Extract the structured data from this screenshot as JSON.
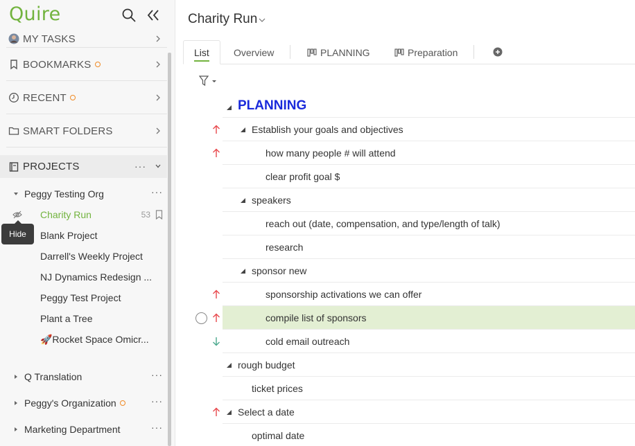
{
  "app": {
    "logo": "Quire",
    "accent": "#72b33e"
  },
  "sidebar": {
    "nav": [
      {
        "label": "MY TASKS",
        "icon": "avatar-icon"
      },
      {
        "label": "BOOKMARKS",
        "icon": "bookmark-icon",
        "dot": true
      },
      {
        "label": "RECENT",
        "icon": "clock-icon",
        "dot": true
      },
      {
        "label": "SMART FOLDERS",
        "icon": "folder-icon"
      }
    ],
    "projects_label": "PROJECTS",
    "orgs": [
      {
        "name": "Peggy Testing Org",
        "expanded": true,
        "projects": [
          {
            "name": "Charity Run",
            "count": "53",
            "active": true
          },
          {
            "name": "Blank Project"
          },
          {
            "name": "Darrell's Weekly Project"
          },
          {
            "name": "NJ Dynamics Redesign ..."
          },
          {
            "name": "Peggy Test Project"
          },
          {
            "name": "Plant a Tree"
          },
          {
            "name": "🚀Rocket Space Omicr..."
          }
        ]
      },
      {
        "name": "Q Translation"
      },
      {
        "name": "Peggy's Organization",
        "dot": true
      },
      {
        "name": "Marketing Department"
      }
    ],
    "tooltip": "Hide"
  },
  "main": {
    "title": "Charity Run",
    "tabs": [
      {
        "label": "List",
        "active": true
      },
      {
        "label": "Overview"
      },
      {
        "label": "PLANNING",
        "icon": "board-icon"
      },
      {
        "label": "Preparation",
        "icon": "board-icon"
      }
    ],
    "tasks": [
      {
        "text": "PLANNING",
        "level": 0,
        "heading": true,
        "caret": true
      },
      {
        "text": "Establish your goals and objectives",
        "level": 1,
        "caret": true,
        "priority": "high"
      },
      {
        "text": "how many people # will attend",
        "level": 2,
        "priority": "high"
      },
      {
        "text": "clear profit goal $",
        "level": 2
      },
      {
        "text": "speakers",
        "level": 1,
        "caret": true
      },
      {
        "text": "reach out (date, compensation, and type/length of talk)",
        "level": 2
      },
      {
        "text": "research",
        "level": 2
      },
      {
        "text": "sponsor new",
        "level": 1,
        "caret": true
      },
      {
        "text": "sponsorship activations we can offer",
        "level": 2,
        "priority": "high"
      },
      {
        "text": "compile list of sponsors",
        "level": 2,
        "priority": "high",
        "selected": true
      },
      {
        "text": "cold email outreach",
        "level": 2,
        "priority": "low"
      },
      {
        "text": "rough budget",
        "level": 0,
        "caret": true
      },
      {
        "text": "ticket prices",
        "level": 1
      },
      {
        "text": "Select a date",
        "level": 0,
        "caret": true,
        "priority": "high"
      },
      {
        "text": "optimal date",
        "level": 1
      }
    ],
    "colors": {
      "priority_high": "#e8474b",
      "priority_low": "#4aa88d",
      "heading": "#1a2adb",
      "selected_row": "#e3efd3"
    }
  }
}
